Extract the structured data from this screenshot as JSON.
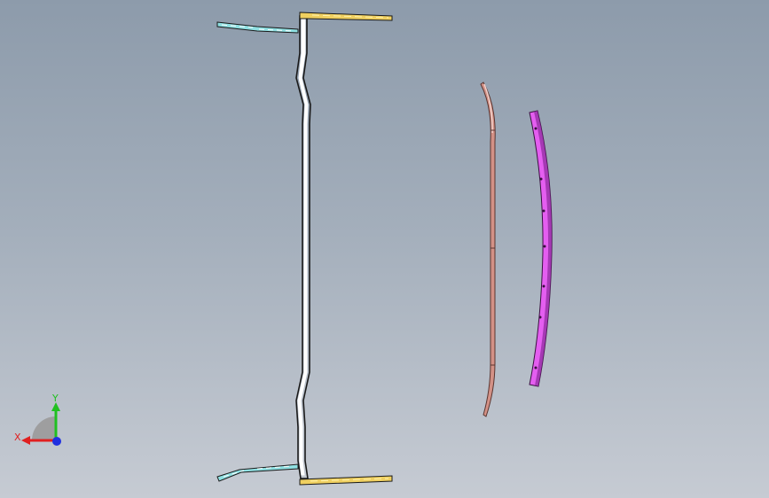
{
  "viewport": {
    "background_top": "#8d9bab",
    "background_bottom": "#c6cbd3"
  },
  "parts": [
    {
      "name": "frame-outline",
      "color": "#ffffff"
    },
    {
      "name": "left-upper-bracket",
      "color": "#7fd3d6"
    },
    {
      "name": "right-upper-bracket",
      "color": "#e6c65a"
    },
    {
      "name": "left-lower-bracket",
      "color": "#7fd3d6"
    },
    {
      "name": "right-lower-bracket",
      "color": "#e6c65a"
    },
    {
      "name": "curved-rail-pink",
      "color": "#c7847a"
    },
    {
      "name": "curved-rail-magenta",
      "color": "#e060e8"
    }
  ],
  "triad": {
    "x_label": "X",
    "y_label": "Y",
    "x_color": "#e02020",
    "y_color": "#20c020",
    "z_color": "#2030e0"
  }
}
